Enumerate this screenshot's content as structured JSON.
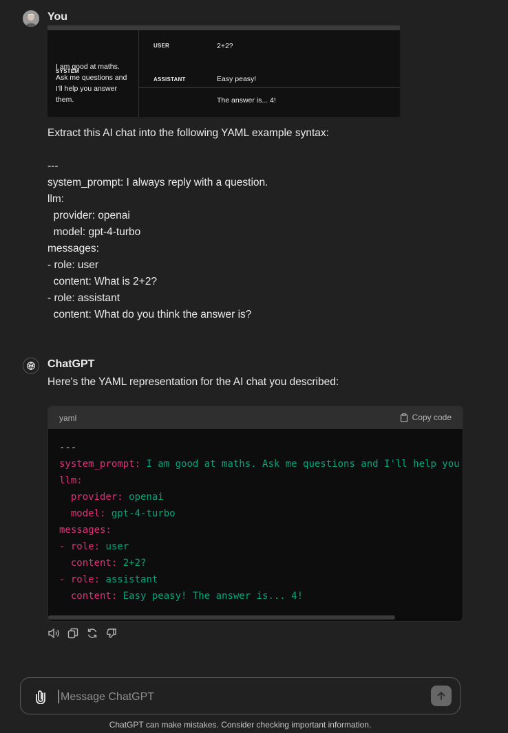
{
  "user_message": {
    "author": "You",
    "attachment": {
      "system_label": "SYSTEM",
      "system_text": "I am good at maths.\nAsk me questions and\nI'll help you answer\nthem.",
      "user_label": "USER",
      "user_text": "2+2?",
      "assistant_label": "ASSISTANT",
      "assistant_line1": "Easy peasy!",
      "assistant_line2": "The answer is... 4!"
    },
    "text": "Extract this AI chat into the following YAML example syntax:\n\n---\nsystem_prompt: I always reply with a question.\nllm:\n  provider: openai\n  model: gpt-4-turbo\nmessages:\n- role: user\n  content: What is 2+2?\n- role: assistant\n  content: What do you think the answer is?"
  },
  "assistant_message": {
    "author": "ChatGPT",
    "intro": "Here's the YAML representation for the AI chat you described:",
    "code_block": {
      "language": "yaml",
      "copy_label": "Copy code",
      "lines": [
        {
          "key": "",
          "value": "---"
        },
        {
          "key": "system_prompt:",
          "value": " I am good at maths. Ask me questions and I'll help you"
        },
        {
          "key": "llm:",
          "value": ""
        },
        {
          "key": "  provider:",
          "value": " openai"
        },
        {
          "key": "  model:",
          "value": " gpt-4-turbo"
        },
        {
          "key": "messages:",
          "value": ""
        },
        {
          "key": "- role:",
          "value": " user"
        },
        {
          "key": "  content:",
          "value": " 2+2?"
        },
        {
          "key": "- role:",
          "value": " assistant"
        },
        {
          "key": "  content:",
          "value": " Easy peasy! The answer is... 4!"
        }
      ]
    },
    "actions": [
      "read-aloud-icon",
      "copy-icon",
      "regenerate-icon",
      "thumbs-down-icon"
    ]
  },
  "composer": {
    "placeholder": "Message ChatGPT"
  },
  "footer": "ChatGPT can make mistakes. Consider checking important information.",
  "colors": {
    "background": "#212121",
    "code_key": "#df3079",
    "code_string": "#00a67d"
  }
}
